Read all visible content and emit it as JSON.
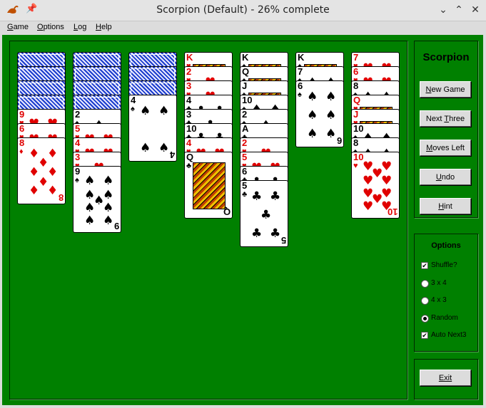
{
  "window": {
    "title": "Scorpion (Default) - 26% complete",
    "icons": {
      "app": "scorpion-icon",
      "pin": "pin-icon",
      "minimize": "chevron-down-icon",
      "maximize": "chevron-up-icon",
      "close": "close-icon"
    }
  },
  "menu": [
    {
      "label": "Game",
      "accel": "G"
    },
    {
      "label": "Options",
      "accel": "O"
    },
    {
      "label": "Log",
      "accel": "L"
    },
    {
      "label": "Help",
      "accel": "H"
    }
  ],
  "colors": {
    "felt": "#008000",
    "red_suit": "#e00000",
    "back": "#2040d0"
  },
  "tableau": [
    {
      "column": 1,
      "cards": [
        "back",
        "back",
        "back",
        "back",
        "9♥",
        "6♥",
        "8♦"
      ]
    },
    {
      "column": 2,
      "cards": [
        "back",
        "back",
        "back",
        "back",
        "2♠",
        "5♥",
        "4♥",
        "3♥",
        "9♠"
      ]
    },
    {
      "column": 3,
      "cards": [
        "back",
        "back",
        "back",
        "4♠"
      ]
    },
    {
      "column": 4,
      "cards": [
        "K♥",
        "2♥",
        "3♥",
        "4♣",
        "3♣",
        "10♣",
        "4♥",
        "Q♣"
      ]
    },
    {
      "column": 5,
      "cards": [
        "K♠",
        "Q♠",
        "J♠",
        "10♠",
        "2♠",
        "A♣",
        "2♥",
        "5♥",
        "6♣",
        "5♣"
      ]
    },
    {
      "column": 6,
      "cards": [
        "K♠",
        "7♠",
        "6♠"
      ]
    },
    {
      "column": 7,
      "cards": [
        "7♥",
        "6♥",
        "8♠",
        "Q♥",
        "J♥",
        "10♠",
        "8♠",
        "10♥"
      ]
    }
  ],
  "side": {
    "game_name": "Scorpion",
    "buttons": [
      {
        "label": "New Game",
        "accel": "N"
      },
      {
        "label": "Next Three",
        "accel": "T"
      },
      {
        "label": "Moves Left",
        "accel": "M"
      },
      {
        "label": "Undo",
        "accel": "U"
      },
      {
        "label": "Hint",
        "accel": "H"
      }
    ],
    "options_title": "Options",
    "options": [
      {
        "label": "Shuffle?",
        "type": "checkbox",
        "checked": true
      },
      {
        "label": "3 x 4",
        "type": "radio",
        "checked": false
      },
      {
        "label": "4 x 3",
        "type": "radio",
        "checked": false
      },
      {
        "label": "Random",
        "type": "radio",
        "checked": true
      },
      {
        "label": "Auto Next3",
        "type": "checkbox",
        "checked": true
      }
    ],
    "exit_label": "Exit"
  }
}
